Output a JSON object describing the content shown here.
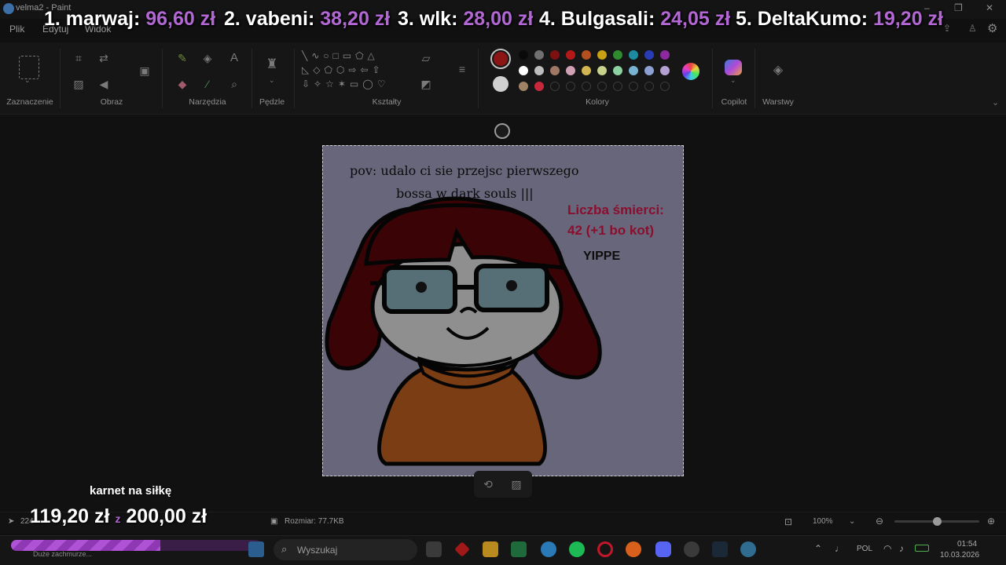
{
  "window": {
    "title": "velma2 - Paint"
  },
  "menu": {
    "file": "Plik",
    "edit": "Edytuj",
    "view": "Widok"
  },
  "ribbon": {
    "groups": [
      "Zaznaczenie",
      "Obraz",
      "Narzędzia",
      "Pędzle",
      "Kształty",
      "Kolory",
      "Copilot",
      "Warstwy"
    ]
  },
  "colors": {
    "primary": "#8b1414",
    "secondary": "#cfcfcf",
    "palette_row1": [
      "#0a0a0a",
      "#707070",
      "#7d1010",
      "#b41919",
      "#b4501e",
      "#c8a014",
      "#2e8c2e",
      "#1e8ca0",
      "#283cb4",
      "#8c28a0"
    ],
    "palette_row2": [
      "#ffffff",
      "#bdbdbd",
      "#a07864",
      "#d2a0b4",
      "#d2b450",
      "#c8d28c",
      "#8cd2a0",
      "#78b4d2",
      "#8ca0d2",
      "#b4a0d2"
    ],
    "palette_row3": [
      "#a08264",
      "#c8283c"
    ]
  },
  "donations": [
    {
      "label": "1. marwaj:",
      "amount": "96,60 zł"
    },
    {
      "label": "2. vabeni:",
      "amount": "38,20 zł"
    },
    {
      "label": "3. wlk:",
      "amount": "28,00 zł"
    },
    {
      "label": "4. Bulgasali:",
      "amount": "24,05 zł"
    },
    {
      "label": "5. DeltaKumo:",
      "amount": "19,20 zł"
    }
  ],
  "drawing": {
    "caption_line1": "pov: udalo ci sie przejsc pierwszego",
    "caption_line2": "bossa w dark souls |||",
    "deaths_line1": "Liczba śmierci:",
    "deaths_line2": "42 (+1 bo kot)",
    "yippe": "YIPPE"
  },
  "goal": {
    "title": "karnet na siłkę",
    "current": "119,20 zł",
    "separator": "z",
    "target": "200,00 zł",
    "progress": 0.596
  },
  "status": {
    "canvas_size": "224",
    "file_size": "Rozmiar: 77.7KB",
    "zoom": "100%",
    "zoom_level": 0.5
  },
  "taskbar": {
    "weather": "Duże zachmurze...",
    "search_placeholder": "Wyszukaj",
    "language": "POL",
    "time": "01:54",
    "date": "10.03.2026"
  }
}
